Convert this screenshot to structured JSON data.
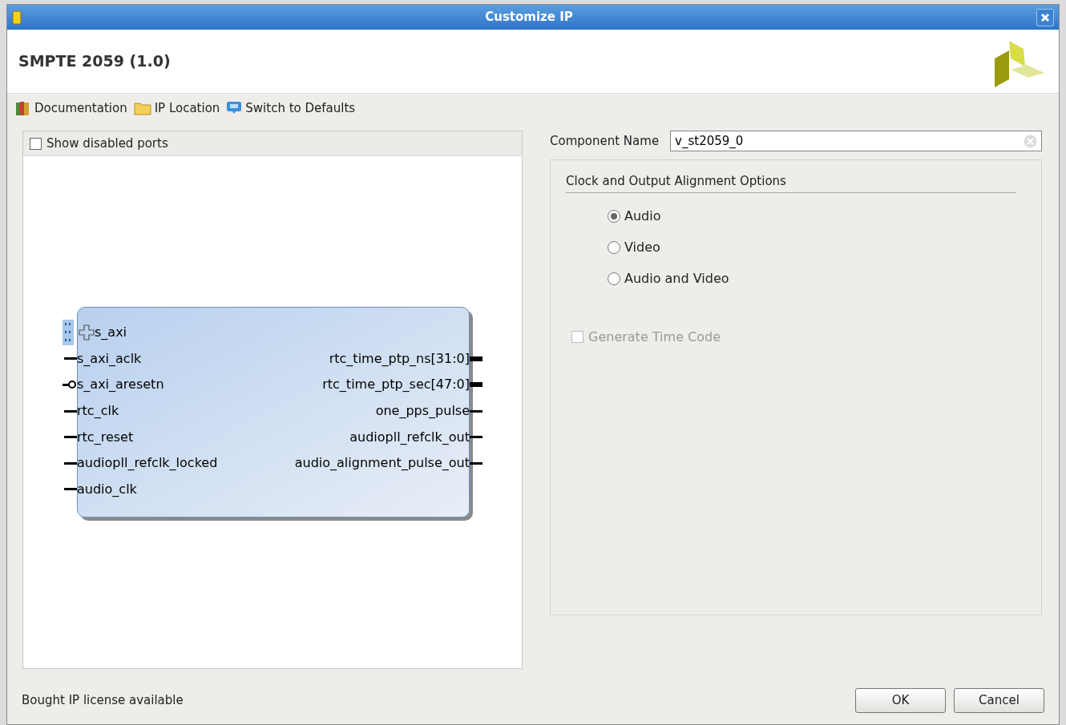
{
  "window": {
    "title": "Customize IP"
  },
  "header": {
    "title": "SMPTE 2059 (1.0)"
  },
  "toolbar": [
    {
      "kind": "book",
      "label": "Documentation"
    },
    {
      "kind": "folder",
      "label": "IP Location"
    },
    {
      "kind": "reset",
      "label": "Switch to Defaults"
    }
  ],
  "ports_panel": {
    "show_disabled_ports": {
      "label": "Show disabled ports",
      "checked": false
    },
    "block": {
      "left_ports": [
        {
          "kind": "bus",
          "name": "s_axi"
        },
        {
          "kind": "plain",
          "name": "s_axi_aclk"
        },
        {
          "kind": "active_low",
          "name": "s_axi_aresetn"
        },
        {
          "kind": "plain",
          "name": "rtc_clk"
        },
        {
          "kind": "plain",
          "name": "rtc_reset"
        },
        {
          "kind": "plain",
          "name": "audiopll_refclk_locked"
        },
        {
          "kind": "plain",
          "name": "audio_clk"
        }
      ],
      "right_ports": [
        {
          "kind": "wide",
          "name": "rtc_time_ptp_ns[31:0]"
        },
        {
          "kind": "wide",
          "name": "rtc_time_ptp_sec[47:0]"
        },
        {
          "kind": "plain",
          "name": "one_pps_pulse"
        },
        {
          "kind": "plain",
          "name": "audiopll_refclk_out"
        },
        {
          "kind": "plain",
          "name": "audio_alignment_pulse_out"
        }
      ]
    }
  },
  "component_name": {
    "label": "Component Name",
    "value": "v_st2059_0"
  },
  "options": {
    "title": "Clock and Output Alignment Options",
    "radios": [
      {
        "label": "Audio",
        "selected": true
      },
      {
        "label": "Video",
        "selected": false
      },
      {
        "label": "Audio and Video",
        "selected": false
      }
    ],
    "generate_time_code": {
      "label": "Generate Time Code",
      "checked": false,
      "disabled": true
    }
  },
  "status": "Bought IP license available",
  "buttons": [
    "OK",
    "Cancel"
  ]
}
